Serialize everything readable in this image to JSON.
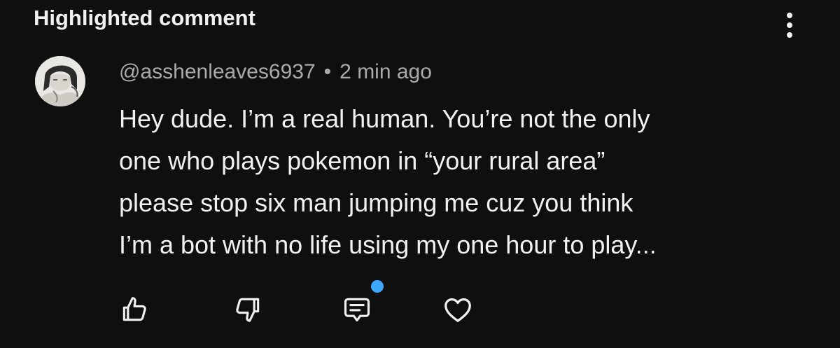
{
  "header": {
    "title": "Highlighted comment",
    "more_icon": "more-vertical-icon"
  },
  "comment": {
    "author": "@asshenleaves6937",
    "separator": "•",
    "timestamp": "2 min ago",
    "text_lines": [
      "Hey dude. I’m a real human. You’re not the only",
      "one who plays pokemon in “your rural area”",
      "please stop six man jumping me cuz you think",
      "I’m a bot with no life using my one hour to play..."
    ]
  },
  "actions": {
    "like_icon": "thumbs-up-icon",
    "dislike_icon": "thumbs-down-icon",
    "reply_icon": "reply-comment-icon",
    "heart_icon": "heart-icon"
  },
  "colors": {
    "background": "#0f0f0f",
    "text_primary": "#f1f1f1",
    "text_secondary": "#aaaaaa",
    "notification_dot": "#3ea6ff"
  }
}
